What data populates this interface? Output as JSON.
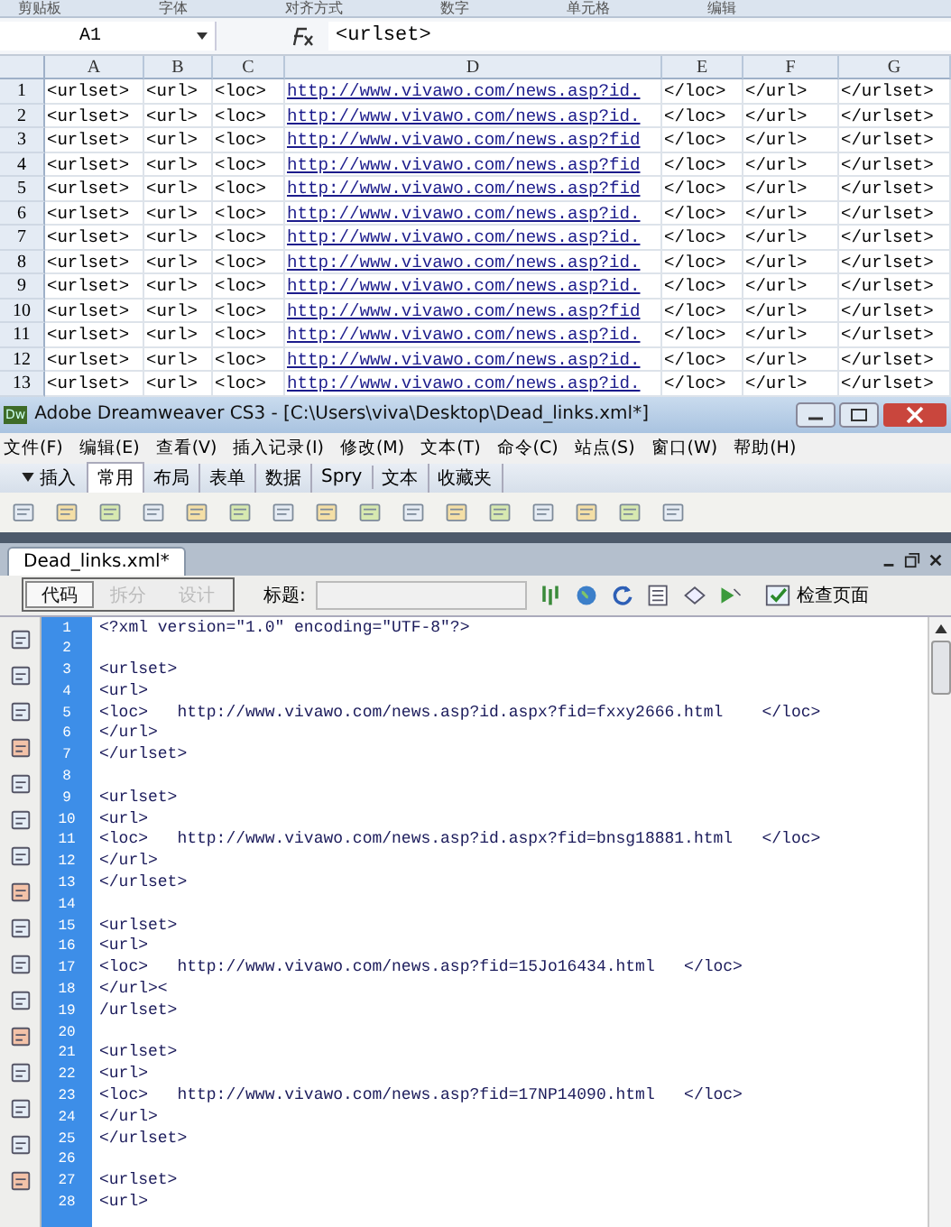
{
  "excel": {
    "ribbon_groups": [
      "剪贴板",
      "字体",
      "对齐方式",
      "数字",
      "单元格",
      "编辑"
    ],
    "name_box": "A1",
    "formula": "<urlset>",
    "columns": [
      "A",
      "B",
      "C",
      "D",
      "E",
      "F",
      "G"
    ],
    "rows": [
      {
        "number": "1",
        "cells": [
          "<urlset>",
          "<url>",
          "<loc>",
          "http://www.vivawo.com/news.asp?id.",
          "</loc>",
          "</url>",
          "</urlset>"
        ]
      },
      {
        "number": "2",
        "cells": [
          "<urlset>",
          "<url>",
          "<loc>",
          "http://www.vivawo.com/news.asp?id.",
          "</loc>",
          "</url>",
          "</urlset>"
        ]
      },
      {
        "number": "3",
        "cells": [
          "<urlset>",
          "<url>",
          "<loc>",
          "http://www.vivawo.com/news.asp?fid",
          "</loc>",
          "</url>",
          "</urlset>"
        ]
      },
      {
        "number": "4",
        "cells": [
          "<urlset>",
          "<url>",
          "<loc>",
          "http://www.vivawo.com/news.asp?fid",
          "</loc>",
          "</url>",
          "</urlset>"
        ]
      },
      {
        "number": "5",
        "cells": [
          "<urlset>",
          "<url>",
          "<loc>",
          "http://www.vivawo.com/news.asp?fid",
          "</loc>",
          "</url>",
          "</urlset>"
        ]
      },
      {
        "number": "6",
        "cells": [
          "<urlset>",
          "<url>",
          "<loc>",
          "http://www.vivawo.com/news.asp?id.",
          "</loc>",
          "</url>",
          "</urlset>"
        ]
      },
      {
        "number": "7",
        "cells": [
          "<urlset>",
          "<url>",
          "<loc>",
          "http://www.vivawo.com/news.asp?id.",
          "</loc>",
          "</url>",
          "</urlset>"
        ]
      },
      {
        "number": "8",
        "cells": [
          "<urlset>",
          "<url>",
          "<loc>",
          "http://www.vivawo.com/news.asp?id.",
          "</loc>",
          "</url>",
          "</urlset>"
        ]
      },
      {
        "number": "9",
        "cells": [
          "<urlset>",
          "<url>",
          "<loc>",
          "http://www.vivawo.com/news.asp?id.",
          "</loc>",
          "</url>",
          "</urlset>"
        ]
      },
      {
        "number": "10",
        "cells": [
          "<urlset>",
          "<url>",
          "<loc>",
          "http://www.vivawo.com/news.asp?fid",
          "</loc>",
          "</url>",
          "</urlset>"
        ]
      },
      {
        "number": "11",
        "cells": [
          "<urlset>",
          "<url>",
          "<loc>",
          "http://www.vivawo.com/news.asp?id.",
          "</loc>",
          "</url>",
          "</urlset>"
        ]
      },
      {
        "number": "12",
        "cells": [
          "<urlset>",
          "<url>",
          "<loc>",
          "http://www.vivawo.com/news.asp?id.",
          "</loc>",
          "</url>",
          "</urlset>"
        ]
      },
      {
        "number": "13",
        "cells": [
          "<urlset>",
          "<url>",
          "<loc>",
          "http://www.vivawo.com/news.asp?id.",
          "</loc>",
          "</url>",
          "</urlset>"
        ]
      }
    ]
  },
  "dreamweaver": {
    "app_icon": "Dw",
    "title": "Adobe Dreamweaver CS3 - [C:\\Users\\viva\\Desktop\\Dead_links.xml*]",
    "menu": [
      "文件(F)",
      "编辑(E)",
      "查看(V)",
      "插入记录(I)",
      "修改(M)",
      "文本(T)",
      "命令(C)",
      "站点(S)",
      "窗口(W)",
      "帮助(H)"
    ],
    "insert_label": "插入",
    "insert_tabs": [
      {
        "label": "常用",
        "selected": true
      },
      {
        "label": "布局",
        "selected": false
      },
      {
        "label": "表单",
        "selected": false
      },
      {
        "label": "数据",
        "selected": false
      },
      {
        "label": "Spry",
        "selected": false
      },
      {
        "label": "文本",
        "selected": false
      },
      {
        "label": "收藏夹",
        "selected": false
      }
    ],
    "document_tab": "Dead_links.xml*",
    "view_buttons": [
      {
        "label": "代码",
        "selected": true
      },
      {
        "label": "拆分",
        "selected": false
      },
      {
        "label": "设计",
        "selected": false
      }
    ],
    "title_label": "标题:",
    "check_page": "检查页面",
    "code_lines": [
      {
        "number": "1",
        "text": "<?xml version=\"1.0\" encoding=\"UTF-8\"?>"
      },
      {
        "number": "2"
      },
      {
        "number": "3",
        "text": "<urlset>"
      },
      {
        "number": "4",
        "text": "<url>"
      },
      {
        "number": "5",
        "text": "<loc>   http://www.vivawo.com/news.asp?id.aspx?fid=fxxy2666.html    </loc>"
      },
      {
        "number": "6",
        "text": "</url>"
      },
      {
        "number": "7",
        "text": "</urlset>"
      },
      {
        "number": "8"
      },
      {
        "number": "9",
        "text": "<urlset>"
      },
      {
        "number": "10",
        "text": "<url>"
      },
      {
        "number": "11",
        "text": "<loc>   http://www.vivawo.com/news.asp?id.aspx?fid=bnsg18881.html   </loc>"
      },
      {
        "number": "12",
        "text": "</url>"
      },
      {
        "number": "13",
        "text": "</urlset>"
      },
      {
        "number": "14"
      },
      {
        "number": "15",
        "text": "<urlset>"
      },
      {
        "number": "16",
        "text": "<url>"
      },
      {
        "number": "17",
        "text": "<loc>   http://www.vivawo.com/news.asp?fid=15Jo16434.html   </loc>"
      },
      {
        "number": "18",
        "text": "</url><"
      },
      {
        "number": "19",
        "text": "/urlset>"
      },
      {
        "number": "20"
      },
      {
        "number": "21",
        "text": "<urlset>"
      },
      {
        "number": "22",
        "text": "<url>"
      },
      {
        "number": "23",
        "text": "<loc>   http://www.vivawo.com/news.asp?fid=17NP14090.html   </loc>"
      },
      {
        "number": "24",
        "text": "</url>"
      },
      {
        "number": "25",
        "text": "</urlset>"
      },
      {
        "number": "26"
      },
      {
        "number": "27",
        "text": "<urlset>"
      },
      {
        "number": "28",
        "text": "<url>"
      }
    ]
  }
}
